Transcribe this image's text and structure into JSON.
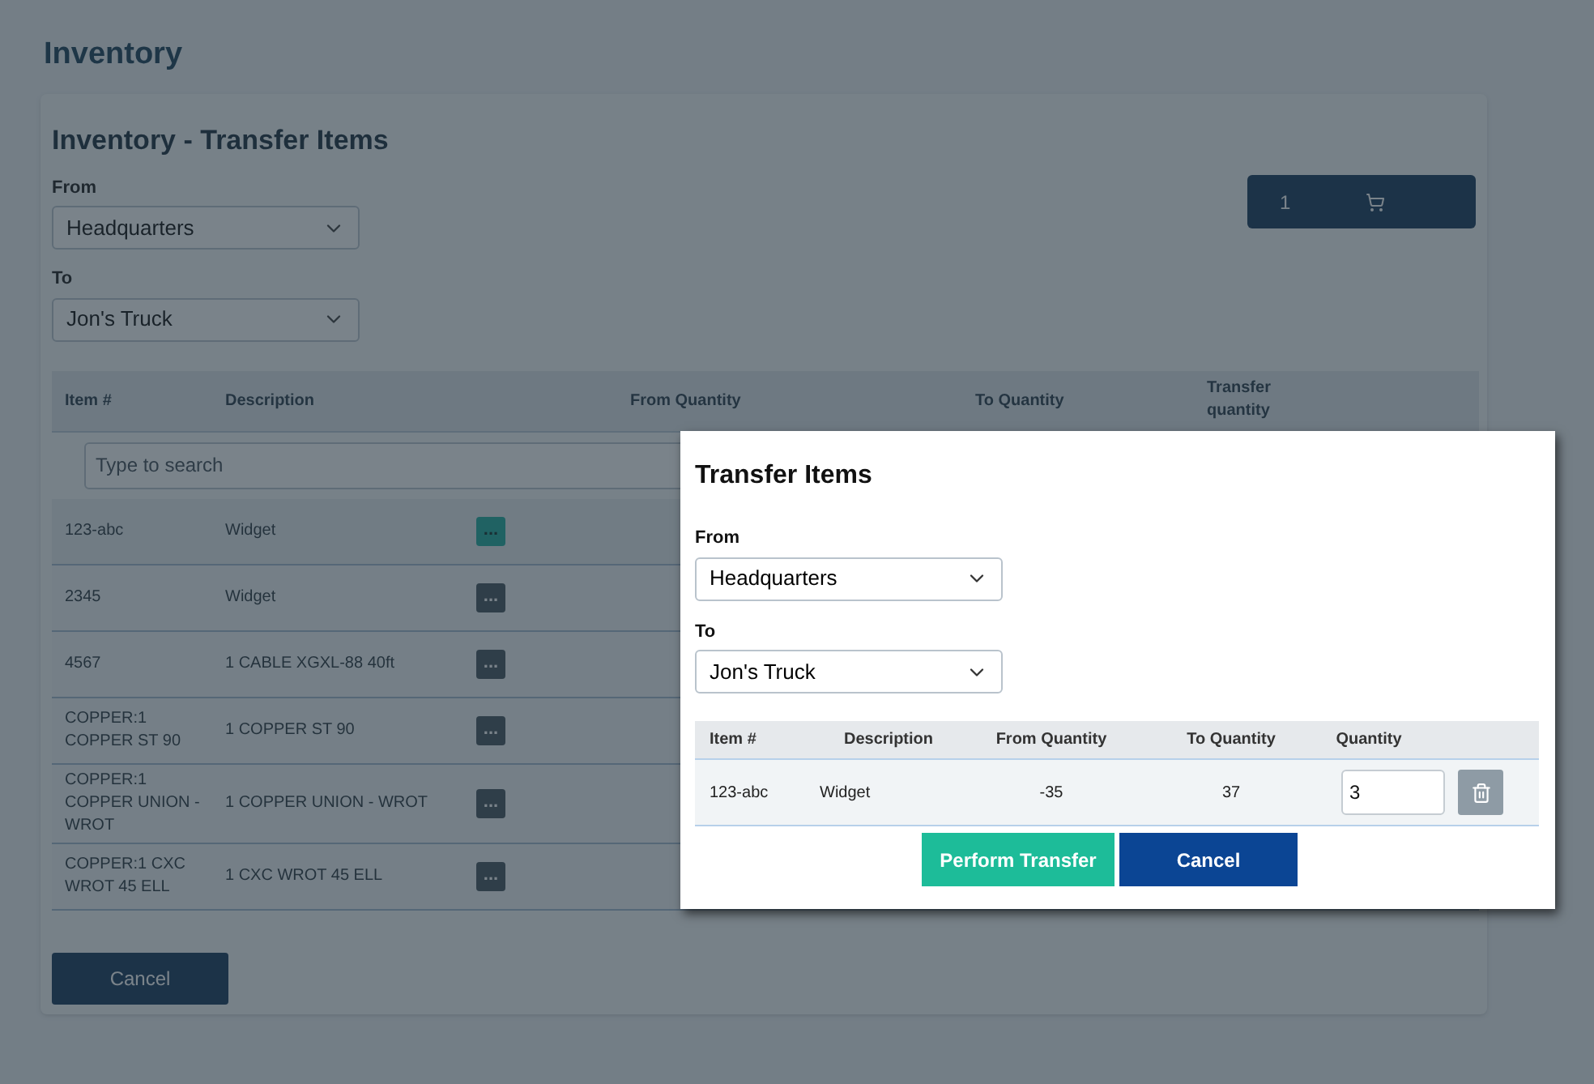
{
  "page_title": "Inventory",
  "panel": {
    "title": "Inventory - Transfer Items",
    "from": {
      "label": "From",
      "value": "Headquarters"
    },
    "to": {
      "label": "To",
      "value": "Jon's Truck"
    },
    "cart": {
      "count": "1"
    },
    "table": {
      "columns": [
        "Item #",
        "Description",
        "From Quantity",
        "To Quantity",
        "Transfer quantity"
      ],
      "search": {
        "placeholder": "Type to search"
      },
      "rows": [
        {
          "item": "123-abc",
          "description": "Widget",
          "more": "...",
          "selected": true
        },
        {
          "item": "2345",
          "description": "Widget",
          "more": "...",
          "selected": false
        },
        {
          "item": "4567",
          "description": "1 CABLE XGXL-88 40ft",
          "more": "...",
          "selected": false
        },
        {
          "item": "COPPER:1 COPPER ST 90",
          "description": "1 COPPER ST 90",
          "more": "...",
          "selected": false
        },
        {
          "item": "COPPER:1 COPPER UNION - WROT",
          "description": "1 COPPER UNION - WROT",
          "more": "...",
          "selected": false
        },
        {
          "item": "COPPER:1 CXC WROT 45 ELL",
          "description": "1 CXC WROT 45 ELL",
          "more": "...",
          "selected": false
        }
      ]
    },
    "cancel": "Cancel"
  },
  "modal": {
    "title": "Transfer Items",
    "from": {
      "label": "From",
      "value": "Headquarters"
    },
    "to": {
      "label": "To",
      "value": "Jon's Truck"
    },
    "table": {
      "columns": [
        "Item #",
        "Description",
        "From Quantity",
        "To Quantity",
        "Quantity"
      ],
      "rows": [
        {
          "item": "123-abc",
          "description": "Widget",
          "from_quantity": "-35",
          "to_quantity": "37",
          "quantity": "3"
        }
      ]
    },
    "buttons": [
      {
        "label": "Perform Transfer",
        "kind": "primary"
      },
      {
        "label": "Cancel",
        "kind": "secondary"
      }
    ]
  }
}
